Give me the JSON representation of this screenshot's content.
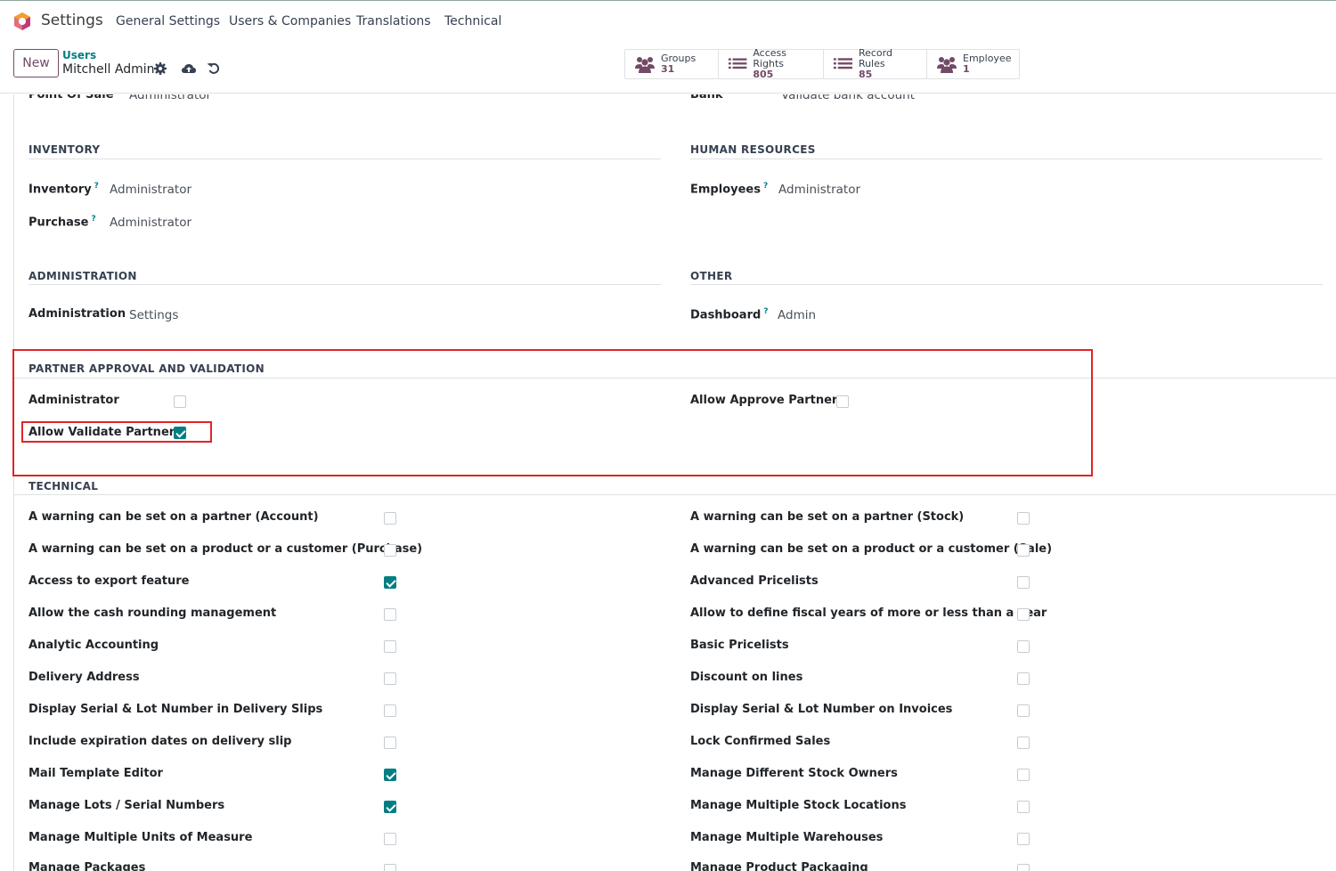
{
  "nav": {
    "app_name": "Settings",
    "menu": [
      "General Settings",
      "Users & Companies",
      "Translations",
      "Technical"
    ]
  },
  "control": {
    "new_label": "New",
    "breadcrumb_parent": "Users",
    "breadcrumb_current": "Mitchell Admin",
    "smart_buttons": [
      {
        "label": "Groups",
        "value": "31",
        "icon": "users-icon"
      },
      {
        "label": "Access Rights",
        "value": "805",
        "icon": "list-icon"
      },
      {
        "label": "Record Rules",
        "value": "85",
        "icon": "list-icon"
      },
      {
        "label": "Employee",
        "value": "1",
        "icon": "users-icon"
      }
    ]
  },
  "clipped_row": {
    "left_label": "Point Of Sale",
    "left_value": "Administrator",
    "right_label": "Bank",
    "right_value": "Validate bank account"
  },
  "inventory": {
    "title": "INVENTORY",
    "fields": [
      {
        "label": "Inventory",
        "help": "?",
        "value": "Administrator"
      },
      {
        "label": "Purchase",
        "help": "?",
        "value": "Administrator"
      }
    ]
  },
  "hr": {
    "title": "HUMAN RESOURCES",
    "fields": [
      {
        "label": "Employees",
        "help": "?",
        "value": "Administrator"
      }
    ]
  },
  "administration": {
    "title": "ADMINISTRATION",
    "fields": [
      {
        "label": "Administration",
        "value": "Settings"
      }
    ]
  },
  "other": {
    "title": "OTHER",
    "fields": [
      {
        "label": "Dashboard",
        "help": "?",
        "value": "Admin"
      }
    ]
  },
  "partner": {
    "title": "PARTNER APPROVAL AND VALIDATION",
    "fields": [
      {
        "label": "Administrator",
        "checked": false
      },
      {
        "label": "Allow Validate Partner",
        "checked": true
      },
      {
        "label": "Allow Approve Partner",
        "checked": false
      }
    ]
  },
  "technical": {
    "title": "TECHNICAL",
    "left": [
      {
        "label": "A warning can be set on a partner (Account)",
        "checked": false
      },
      {
        "label": "A warning can be set on a product or a customer (Purchase)",
        "checked": false
      },
      {
        "label": "Access to export feature",
        "checked": true
      },
      {
        "label": "Allow the cash rounding management",
        "checked": false
      },
      {
        "label": "Analytic Accounting",
        "checked": false
      },
      {
        "label": "Delivery Address",
        "checked": false
      },
      {
        "label": "Display Serial & Lot Number in Delivery Slips",
        "checked": false
      },
      {
        "label": "Include expiration dates on delivery slip",
        "checked": false
      },
      {
        "label": "Mail Template Editor",
        "checked": true
      },
      {
        "label": "Manage Lots / Serial Numbers",
        "checked": true
      },
      {
        "label": "Manage Multiple Units of Measure",
        "checked": false
      },
      {
        "label": "Manage Packages",
        "checked": false
      }
    ],
    "right": [
      {
        "label": "A warning can be set on a partner (Stock)",
        "checked": false
      },
      {
        "label": "A warning can be set on a product or a customer (Sale)",
        "checked": false
      },
      {
        "label": "Advanced Pricelists",
        "checked": false
      },
      {
        "label": "Allow to define fiscal years of more or less than a year",
        "checked": false
      },
      {
        "label": "Basic Pricelists",
        "checked": false
      },
      {
        "label": "Discount on lines",
        "checked": false
      },
      {
        "label": "Display Serial & Lot Number on Invoices",
        "checked": false
      },
      {
        "label": "Lock Confirmed Sales",
        "checked": false
      },
      {
        "label": "Manage Different Stock Owners",
        "checked": false
      },
      {
        "label": "Manage Multiple Stock Locations",
        "checked": false
      },
      {
        "label": "Manage Multiple Warehouses",
        "checked": false
      },
      {
        "label": "Manage Product Packaging",
        "checked": false
      }
    ]
  },
  "colors": {
    "brand": "#714b67",
    "accent": "#017e84",
    "highlight": "#e02424"
  }
}
